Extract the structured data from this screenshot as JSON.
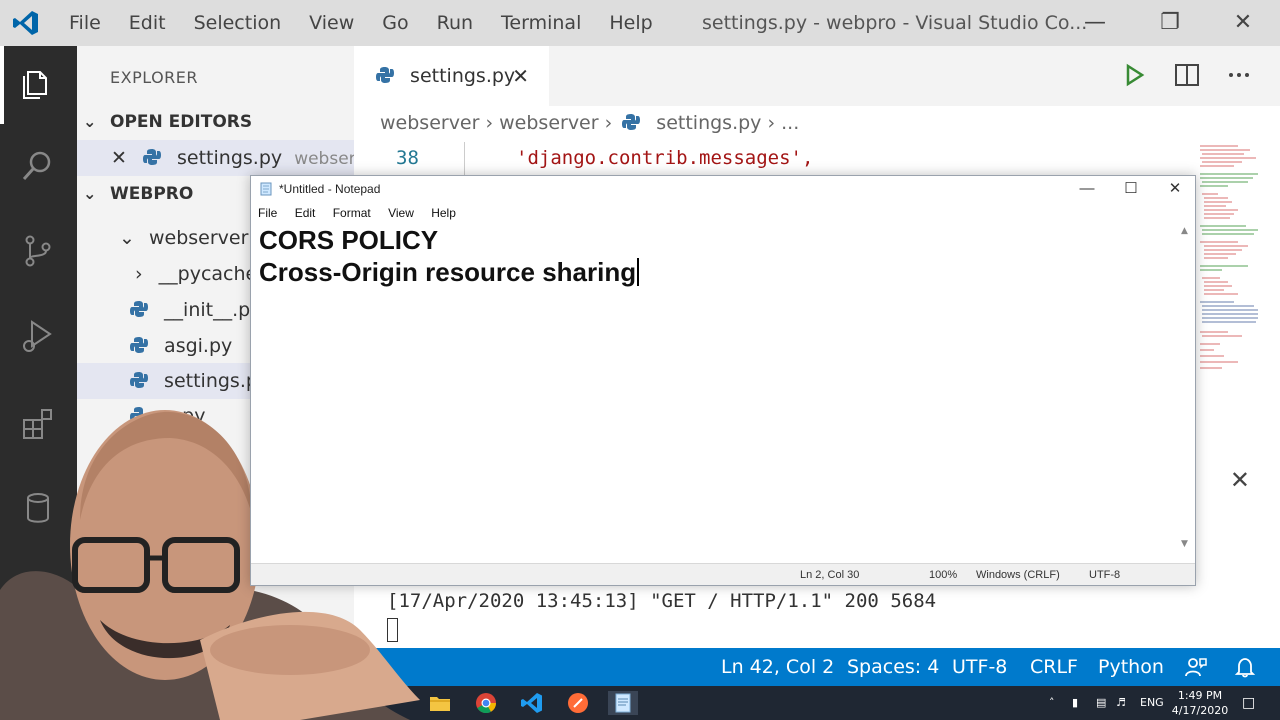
{
  "vscode": {
    "menu": [
      "File",
      "Edit",
      "Selection",
      "View",
      "Go",
      "Run",
      "Terminal",
      "Help"
    ],
    "window_title": "settings.py - webpro - Visual Studio Co...",
    "sidebar": {
      "title": "EXPLORER",
      "open_editors_label": "OPEN EDITORS",
      "open_editor": {
        "name": "settings.py",
        "path": "webser..."
      },
      "project_label": "WEBPRO",
      "tree": [
        {
          "label": "webserver",
          "type": "folder-open"
        },
        {
          "label": "__pycache",
          "type": "folder"
        },
        {
          "label": "__init__.py",
          "type": "file"
        },
        {
          "label": "asgi.py",
          "type": "file"
        },
        {
          "label": "settings.py",
          "type": "file",
          "selected": true
        },
        {
          "label": "...py",
          "type": "file"
        }
      ]
    },
    "tab": {
      "label": "settings.py"
    },
    "breadcrumb": [
      "webserver",
      "webserver",
      "settings.py",
      "..."
    ],
    "editor": {
      "line_number": "38",
      "code": "'django.contrib.messages',"
    },
    "terminal": {
      "line": "[17/Apr/2020 13:45:13] \"GET / HTTP/1.1\" 200 5684"
    },
    "statusbar": {
      "position": "Ln 42, Col 2",
      "spaces": "Spaces: 4",
      "encoding": "UTF-8",
      "eol": "CRLF",
      "language": "Python"
    }
  },
  "notepad": {
    "title": "*Untitled - Notepad",
    "menu": [
      "File",
      "Edit",
      "Format",
      "View",
      "Help"
    ],
    "lines": [
      "CORS POLICY",
      "Cross-Origin resource sharing"
    ],
    "status": {
      "position": "Ln 2, Col 30",
      "zoom": "100%",
      "eol": "Windows (CRLF)",
      "encoding": "UTF-8"
    }
  },
  "taskbar": {
    "lang": "ENG",
    "time": "1:49 PM",
    "date": "4/17/2020"
  },
  "colors": {
    "accent": "#007acc",
    "activitybar": "#2c2c2c",
    "python_blue": "#3572a5"
  },
  "icons": [
    "vscode-logo-icon",
    "explorer-icon",
    "search-icon",
    "source-control-icon",
    "run-debug-icon",
    "extensions-icon",
    "database-icon",
    "settings-gear-icon",
    "python-file-icon",
    "run-icon",
    "split-editor-icon",
    "more-actions-icon",
    "notepad-icon",
    "feedback-icon",
    "bell-icon"
  ]
}
